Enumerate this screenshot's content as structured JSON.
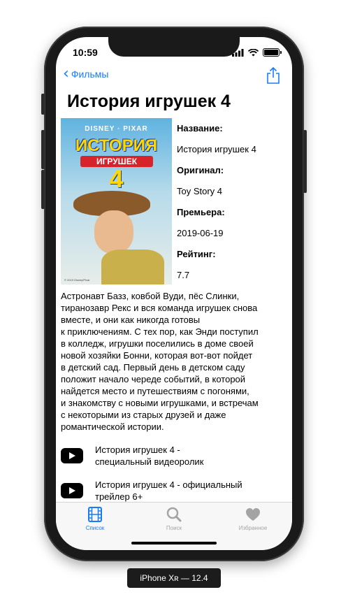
{
  "status_bar": {
    "time": "10:59"
  },
  "nav": {
    "back_label": "Фильмы"
  },
  "movie": {
    "title": "История игрушек 4",
    "poster": {
      "brand": "DISNEY · PIXAR",
      "line1": "ИСТОРИЯ",
      "line2": "ИГРУШЕК",
      "line3": "4",
      "copyright": "© 2019 Disney/Pixar"
    },
    "fields": [
      {
        "label": "Название:",
        "value": "История игрушек 4"
      },
      {
        "label": "Оригинал:",
        "value": "Toy Story 4"
      },
      {
        "label": "Премьера:",
        "value": "2019-06-19"
      },
      {
        "label": "Рейтинг:",
        "value": "7.7"
      }
    ],
    "description": "Астронавт Базз, ковбой Вуди, пёс Слинки,\nтиранозавр Рекс и вся команда игрушек снова\nвместе, и они как никогда готовы\nк приключениям. С тех пор, как Энди поступил\nв колледж, игрушки поселились в доме своей\nновой хозяйки Бонни, которая вот-вот пойдет\nв детский сад. Первый день в детском саду\nположит начало череде событий, в которой\nнайдется место и путешествиям с погонями,\nи знакомству с новыми игрушками, и встречам\nс некоторыми из старых друзей и даже\nромантической истории."
  },
  "videos": [
    {
      "title_line1": "История игрушек 4 -",
      "title_line2": "специальный видеоролик",
      "icon": "youtube-play-icon"
    },
    {
      "title_line1": "История игрушек 4 - официальный",
      "title_line2": "трейлер 6+",
      "icon": "youtube-play-icon"
    }
  ],
  "tabbar": {
    "tabs": [
      {
        "label": "Список",
        "icon": "film-grid-icon",
        "active": true
      },
      {
        "label": "Поиск",
        "icon": "search-icon",
        "active": false
      },
      {
        "label": "Избранное",
        "icon": "heart-icon",
        "active": false
      }
    ]
  },
  "device_label": "iPhone Xʀ — 12.4",
  "colors": {
    "accent": "#1a7cf5",
    "inactive": "#a3a3a3"
  }
}
